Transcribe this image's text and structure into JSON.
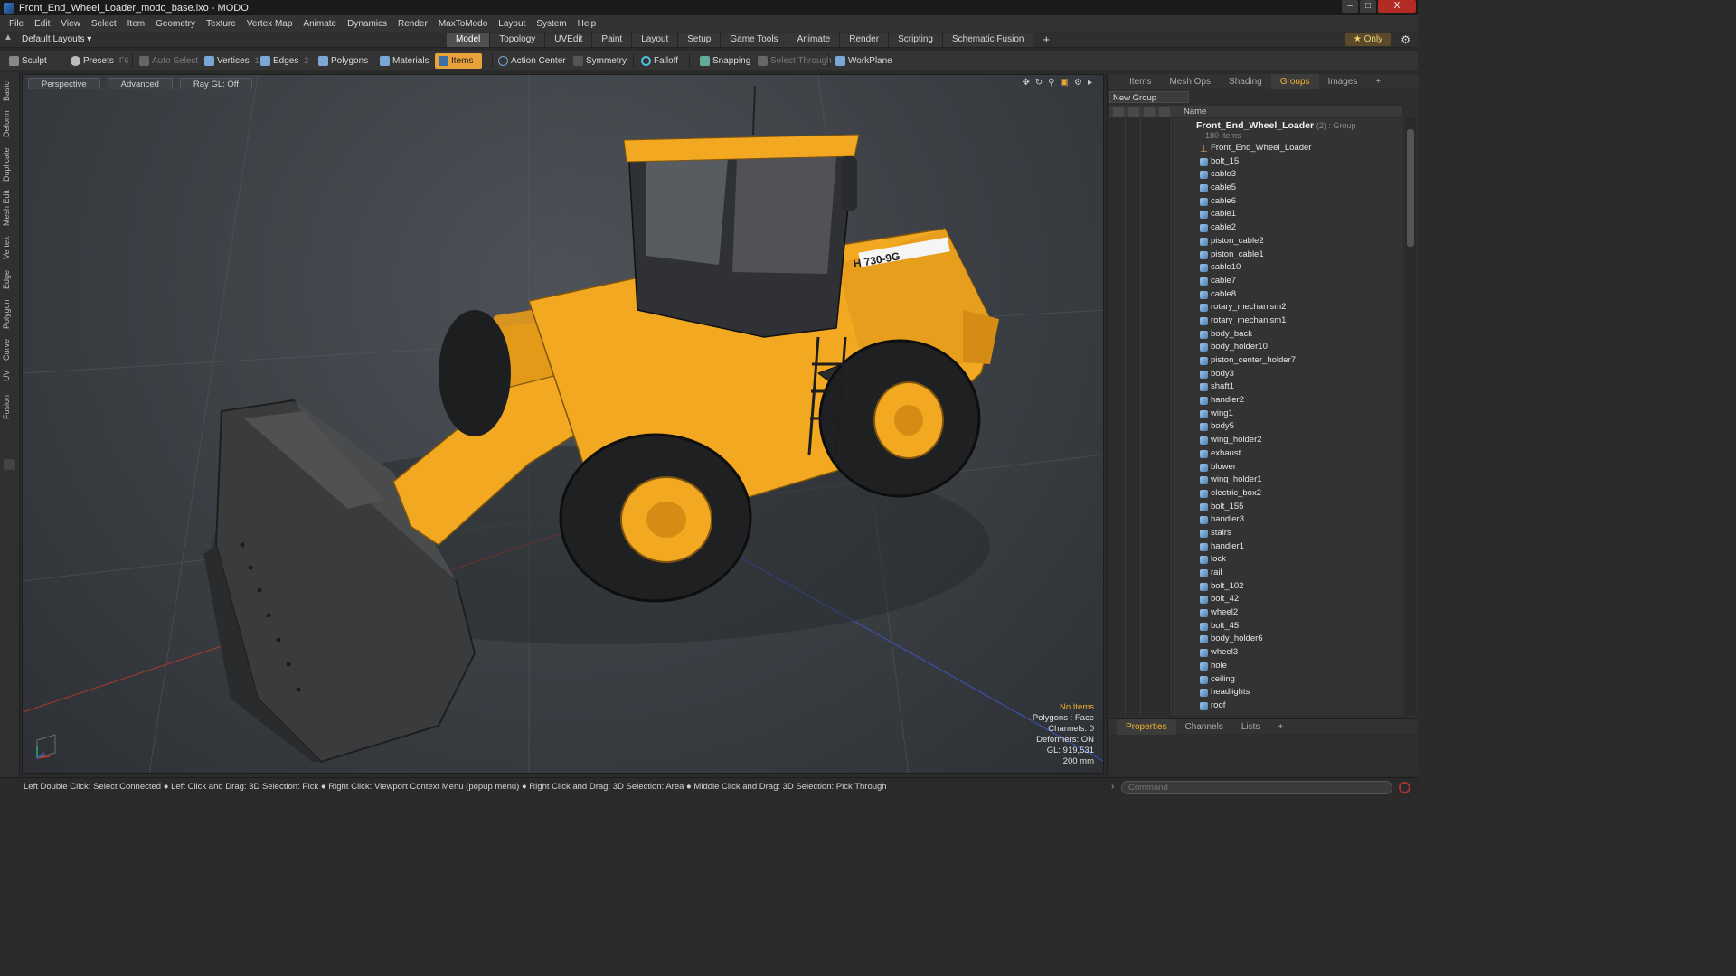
{
  "window": {
    "title": "Front_End_Wheel_Loader_modo_base.lxo - MODO",
    "minimize": "–",
    "maximize": "□",
    "close": "X"
  },
  "menu": [
    "File",
    "Edit",
    "View",
    "Select",
    "Item",
    "Geometry",
    "Texture",
    "Vertex Map",
    "Animate",
    "Dynamics",
    "Render",
    "MaxToModo",
    "Layout",
    "System",
    "Help"
  ],
  "layouts": {
    "label": "Default Layouts ▾"
  },
  "tabs": [
    "Model",
    "Topology",
    "UVEdit",
    "Paint",
    "Layout",
    "Setup",
    "Game Tools",
    "Animate",
    "Render",
    "Scripting",
    "Schematic Fusion"
  ],
  "tab_plus": "+",
  "only_label": "★ Only",
  "tools": {
    "sculpt": "Sculpt",
    "presets": "Presets",
    "presets_key": "F6",
    "auto_select": "Auto Select",
    "vertices": "Vertices",
    "vertices_key": "1",
    "edges": "Edges",
    "edges_key": "2",
    "polygons": "Polygons",
    "materials": "Materials",
    "items": "Items",
    "action_center": "Action Center",
    "symmetry": "Symmetry",
    "falloff": "Falloff",
    "snapping": "Snapping",
    "select_through": "Select Through",
    "workplane": "WorkPlane"
  },
  "left_tabs": [
    "Basic",
    "Deform",
    "Duplicate",
    "Mesh Edit",
    "Vertex",
    "Edge",
    "Polygon",
    "Curve",
    "UV",
    "Fusion"
  ],
  "viewport": {
    "perspective": "Perspective",
    "advanced": "Advanced",
    "raygl": "Ray GL: Off",
    "info": {
      "no_items": "No Items",
      "polygons": "Polygons : Face",
      "channels": "Channels: 0",
      "deformers": "Deformers: ON",
      "gl": "GL: 919,531",
      "size": "200 mm"
    },
    "model_label": "H 730-9G"
  },
  "right_panel": {
    "tabs": [
      "Items",
      "Mesh Ops",
      "Shading",
      "Groups",
      "Images"
    ],
    "active_tab": "Groups",
    "new_group": "New Group",
    "column_name": "Name",
    "group_name": "Front_End_Wheel_Loader",
    "group_meta": "(2) : Group",
    "group_count": "180 Items",
    "items": [
      "Front_End_Wheel_Loader",
      "bolt_15",
      "cable3",
      "cable5",
      "cable6",
      "cable1",
      "cable2",
      "piston_cable2",
      "piston_cable1",
      "cable10",
      "cable7",
      "cable8",
      "rotary_mechanism2",
      "rotary_mechanism1",
      "body_back",
      "body_holder10",
      "piston_center_holder7",
      "body3",
      "shaft1",
      "handler2",
      "wing1",
      "body5",
      "wing_holder2",
      "exhaust",
      "blower",
      "wing_holder1",
      "electric_box2",
      "bolt_155",
      "handler3",
      "stairs",
      "handler1",
      "lock",
      "rail",
      "bolt_102",
      "bolt_42",
      "wheel2",
      "bolt_45",
      "body_holder6",
      "wheel3",
      "hole",
      "ceiling",
      "headlights",
      "roof"
    ]
  },
  "properties_panel": {
    "tabs": [
      "Properties",
      "Channels",
      "Lists"
    ],
    "active_tab": "Properties"
  },
  "status": {
    "hint": "Left Double Click: Select Connected ● Left Click and Drag: 3D Selection: Pick ● Right Click: Viewport Context Menu (popup menu) ● Right Click and Drag: 3D Selection: Area ● Middle Click and Drag: 3D Selection: Pick Through",
    "command_placeholder": "Command"
  },
  "colors": {
    "accent": "#e8a23a",
    "loader_yellow": "#f2a820",
    "viewport_bg": "#3b3f44"
  }
}
